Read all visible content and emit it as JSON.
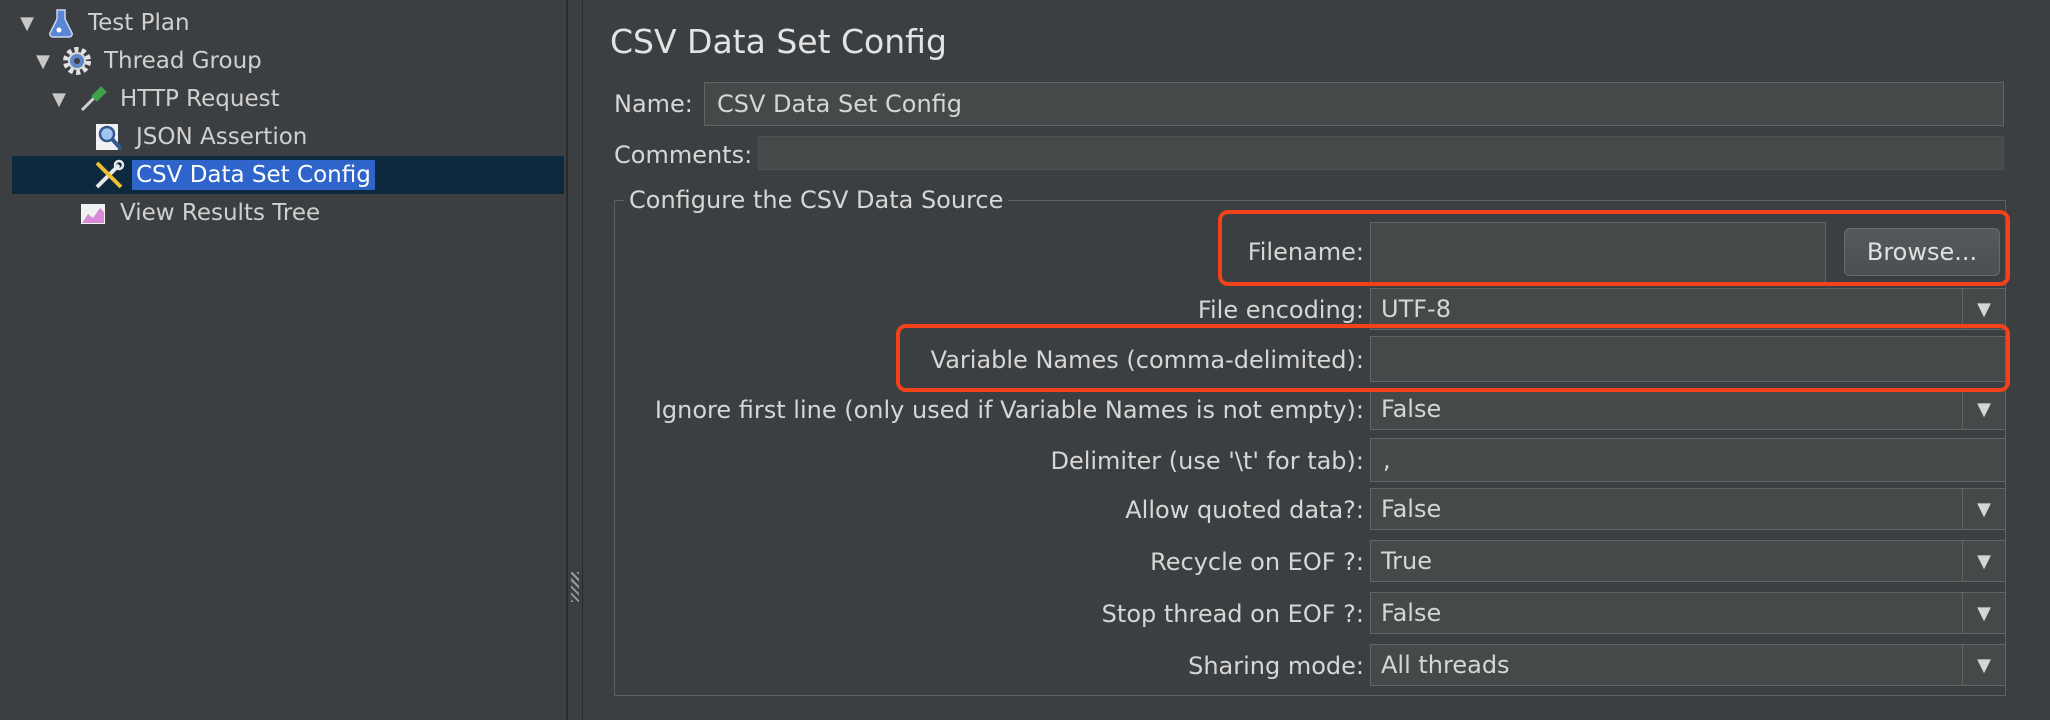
{
  "tree": {
    "items": [
      {
        "label": "Test Plan",
        "icon": "flask-icon",
        "toggle": "▼"
      },
      {
        "label": "Thread Group",
        "icon": "gear-icon",
        "toggle": "▼"
      },
      {
        "label": "HTTP Request",
        "icon": "pipette-icon",
        "toggle": "▼"
      },
      {
        "label": "JSON Assertion",
        "icon": "magnifier-icon",
        "toggle": ""
      },
      {
        "label": "CSV Data Set Config",
        "icon": "tools-icon",
        "toggle": ""
      },
      {
        "label": "View Results Tree",
        "icon": "chart-icon",
        "toggle": ""
      }
    ]
  },
  "main": {
    "title": "CSV Data Set Config",
    "name_label": "Name:",
    "name_value": "CSV Data Set Config",
    "comments_label": "Comments:",
    "comments_value": "",
    "group_title": "Configure the CSV Data Source",
    "fields": {
      "filename_label": "Filename:",
      "filename_value": "",
      "browse_label": "Browse...",
      "encoding_label": "File encoding:",
      "encoding_value": "UTF-8",
      "varnames_label": "Variable Names (comma-delimited):",
      "varnames_value": "",
      "ignore_label": "Ignore first line (only used if Variable Names is not empty):",
      "ignore_value": "False",
      "delimiter_label": "Delimiter (use '\\t' for tab):",
      "delimiter_value": ",",
      "quoted_label": "Allow quoted data?:",
      "quoted_value": "False",
      "recycle_label": "Recycle on EOF ?:",
      "recycle_value": "True",
      "stop_label": "Stop thread on EOF ?:",
      "stop_value": "False",
      "sharing_label": "Sharing mode:",
      "sharing_value": "All threads"
    }
  },
  "colors": {
    "highlight": "#f1421c",
    "selection": "#2f65ca",
    "background": "#3c3f41"
  }
}
